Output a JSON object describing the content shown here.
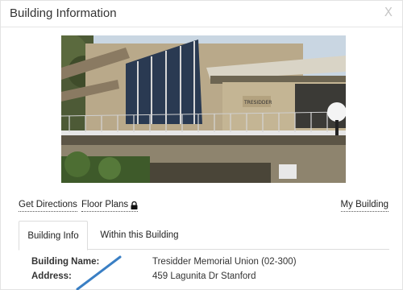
{
  "dialog": {
    "title": "Building Information",
    "close_label": "X"
  },
  "links": {
    "directions": "Get Directions",
    "floor_plans": "Floor Plans",
    "my_building": "My Building"
  },
  "tabs": [
    {
      "label": "Building Info",
      "active": true
    },
    {
      "label": "Within this Building",
      "active": false
    }
  ],
  "info": {
    "building_name_label": "Building Name:",
    "building_name_value": "Tresidder Memorial Union (02-300)",
    "address_label": "Address:",
    "address_value": "459 Lagunita Dr Stanford"
  },
  "photo": {
    "sign_text": "TRESIDDER"
  },
  "colors": {
    "accent_pointer": "#3a7fc4",
    "border": "#dcdcdc"
  }
}
